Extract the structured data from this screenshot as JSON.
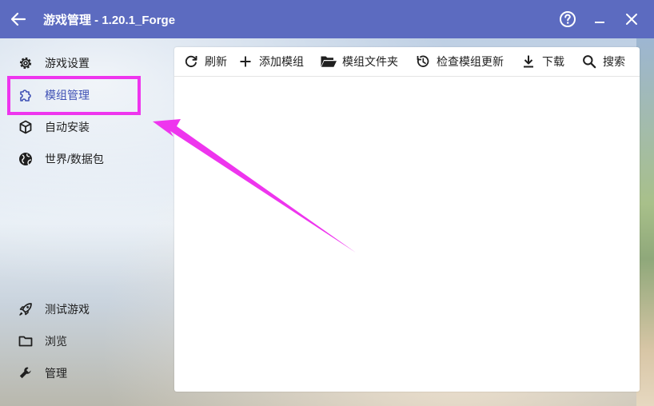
{
  "window": {
    "title": "游戏管理 - 1.20.1_Forge",
    "titlebar_color": "#5c6bc0",
    "icons": {
      "back": "back-arrow-icon",
      "help": "help-icon",
      "minimize": "minimize-icon",
      "close": "close-icon"
    }
  },
  "sidebar": {
    "top_items": [
      {
        "label": "游戏设置",
        "icon": "gear-icon"
      },
      {
        "label": "模组管理",
        "icon": "puzzle-icon",
        "active": true
      },
      {
        "label": "自动安装",
        "icon": "box-icon"
      },
      {
        "label": "世界/数据包",
        "icon": "globe-icon"
      }
    ],
    "bottom_items": [
      {
        "label": "测试游戏",
        "icon": "rocket-icon"
      },
      {
        "label": "浏览",
        "icon": "folder-icon"
      },
      {
        "label": "管理",
        "icon": "wrench-icon"
      }
    ],
    "accent_color": "#3f51b5"
  },
  "toolbar": {
    "items": [
      {
        "label": "刷新",
        "icon": "refresh-icon"
      },
      {
        "label": "添加模组",
        "icon": "plus-icon"
      },
      {
        "label": "模组文件夹",
        "icon": "folder-open-icon"
      },
      {
        "label": "检查模组更新",
        "icon": "update-check-icon"
      },
      {
        "label": "下载",
        "icon": "download-icon"
      },
      {
        "label": "搜索",
        "icon": "search-icon"
      }
    ]
  },
  "annotation": {
    "highlight_color": "#ee35ee"
  }
}
